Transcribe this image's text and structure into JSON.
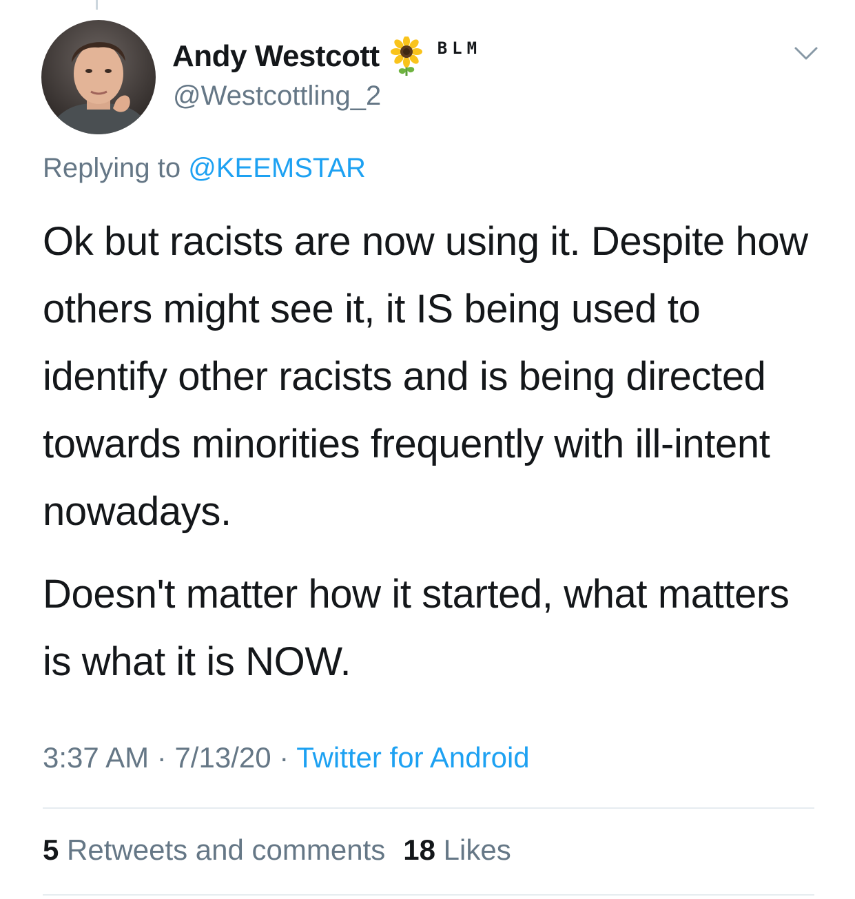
{
  "user": {
    "display_name": "Andy Westcott",
    "name_emoji": "sunflower-emoji",
    "name_suffix": "BLM",
    "handle": "@Westcottling_2"
  },
  "reply": {
    "prefix": "Replying to",
    "mention": "@KEEMSTAR"
  },
  "tweet": {
    "paragraphs": [
      "Ok but racists are now using it. Despite how others might see it, it IS being used to identify other racists and is being directed towards minorities frequently with ill-intent nowadays.",
      "Doesn't matter how it started, what matters is what it is NOW."
    ]
  },
  "meta": {
    "time": "3:37 AM",
    "separator": "·",
    "date": "7/13/20",
    "source": "Twitter for Android"
  },
  "stats": {
    "retweets_count": "5",
    "retweets_label": "Retweets and comments",
    "likes_count": "18",
    "likes_label": "Likes"
  },
  "icons": {
    "menu": "chevron-down-icon"
  },
  "colors": {
    "link": "#1da1f2",
    "secondary_text": "#657786",
    "primary_text": "#14171a",
    "divider": "#e6ecf0"
  }
}
